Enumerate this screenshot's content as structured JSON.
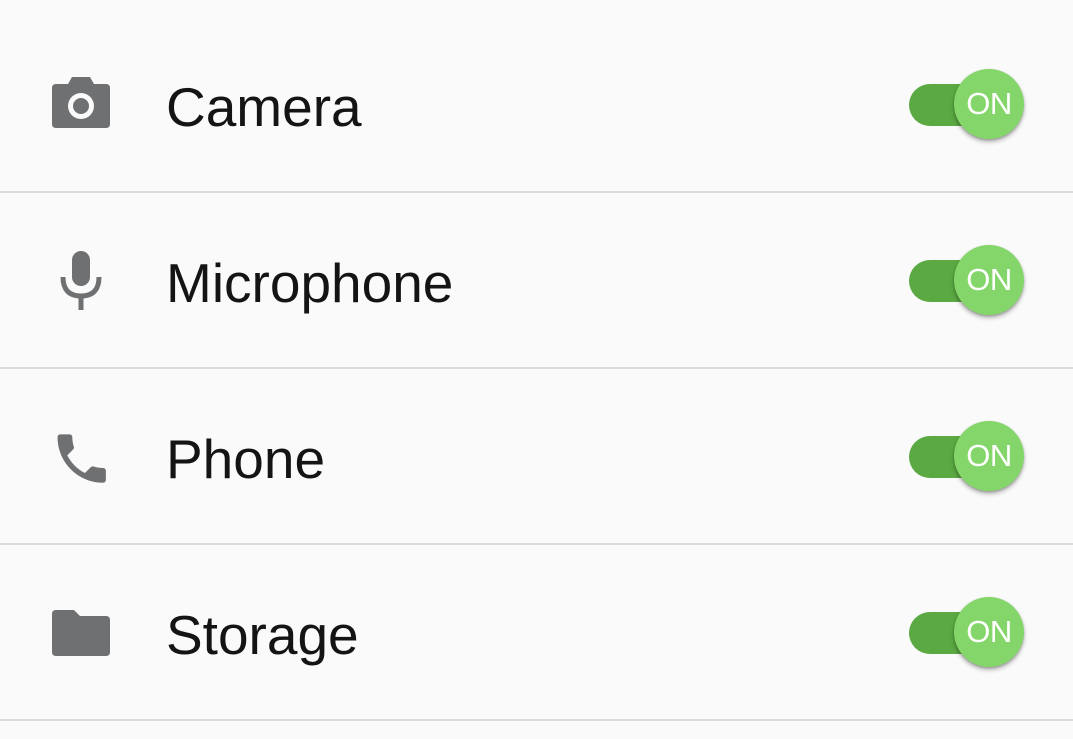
{
  "permissions": {
    "items": [
      {
        "label": "Camera",
        "icon": "camera-icon",
        "state": "ON",
        "enabled": true
      },
      {
        "label": "Microphone",
        "icon": "microphone-icon",
        "state": "ON",
        "enabled": true
      },
      {
        "label": "Phone",
        "icon": "phone-icon",
        "state": "ON",
        "enabled": true
      },
      {
        "label": "Storage",
        "icon": "folder-icon",
        "state": "ON",
        "enabled": true
      }
    ]
  },
  "colors": {
    "background": "#fafafa",
    "icon": "#6f7072",
    "switch_track": "#5aa942",
    "switch_thumb": "#84d66b",
    "divider": "#dadada"
  }
}
